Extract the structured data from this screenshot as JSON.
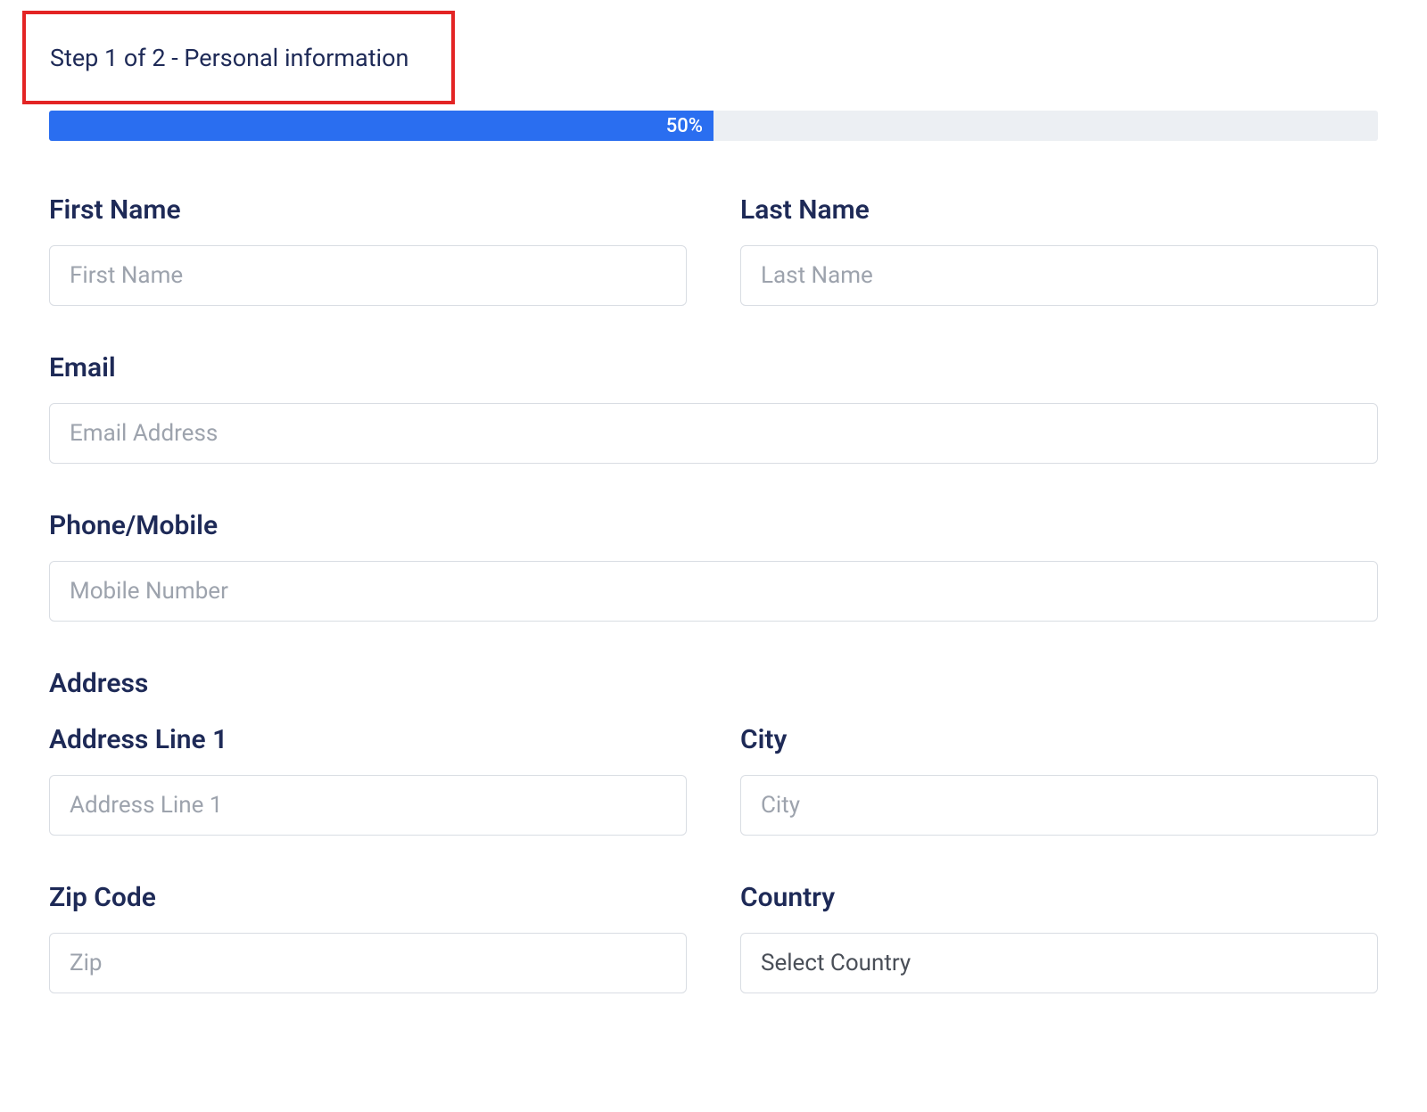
{
  "step": {
    "header": "Step 1 of 2 - Personal information"
  },
  "progress": {
    "percent_label": "50%",
    "width": "50%"
  },
  "fields": {
    "first_name": {
      "label": "First Name",
      "placeholder": "First Name",
      "value": ""
    },
    "last_name": {
      "label": "Last Name",
      "placeholder": "Last Name",
      "value": ""
    },
    "email": {
      "label": "Email",
      "placeholder": "Email Address",
      "value": ""
    },
    "phone": {
      "label": "Phone/Mobile",
      "placeholder": "Mobile Number",
      "value": ""
    },
    "address_section": {
      "label": "Address"
    },
    "address_line_1": {
      "label": "Address Line 1",
      "placeholder": "Address Line 1",
      "value": ""
    },
    "city": {
      "label": "City",
      "placeholder": "City",
      "value": ""
    },
    "zip": {
      "label": "Zip Code",
      "placeholder": "Zip",
      "value": ""
    },
    "country": {
      "label": "Country",
      "selected": "Select Country"
    }
  },
  "colors": {
    "highlight_border": "#e32424",
    "progress_fill": "#2a6ef0",
    "progress_track": "#eceff3",
    "label_text": "#1e2a57",
    "input_border": "#d9dde3",
    "placeholder": "#9da3ad"
  }
}
